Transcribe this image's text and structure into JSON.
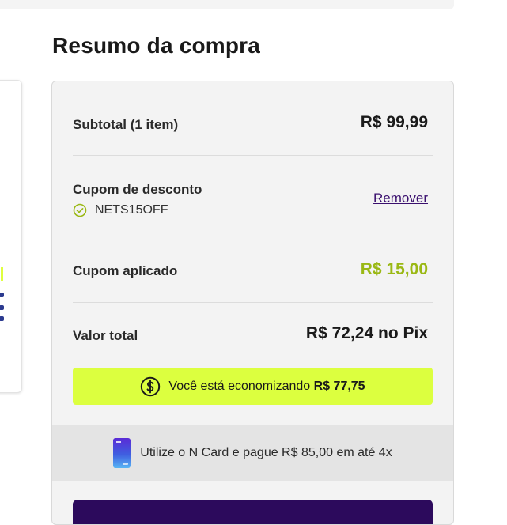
{
  "page": {
    "title": "Resumo da compra"
  },
  "summary": {
    "subtotal_label": "Subtotal (1 item)",
    "subtotal_value": "R$ 99,99",
    "coupon_label": "Cupom de desconto",
    "coupon_code": "NETS15OFF",
    "remove_label": "Remover",
    "applied_label": "Cupom aplicado",
    "applied_value": "R$ 15,00",
    "total_label": "Valor total",
    "total_value": "R$ 72,24 no Pix"
  },
  "savings": {
    "text": "Você está economizando ",
    "amount": "R$ 77,75"
  },
  "card_promo": {
    "text": "Utilize o N Card e pague R$ 85,00 em até 4x"
  },
  "colors": {
    "accent_lime": "#dcff3f",
    "applied_green": "#9ab814",
    "brand_purple": "#2c0a5c",
    "link_purple": "#3a0f6e"
  },
  "icons": [
    "check-circle-icon",
    "dollar-circle-icon",
    "n-card-icon"
  ]
}
